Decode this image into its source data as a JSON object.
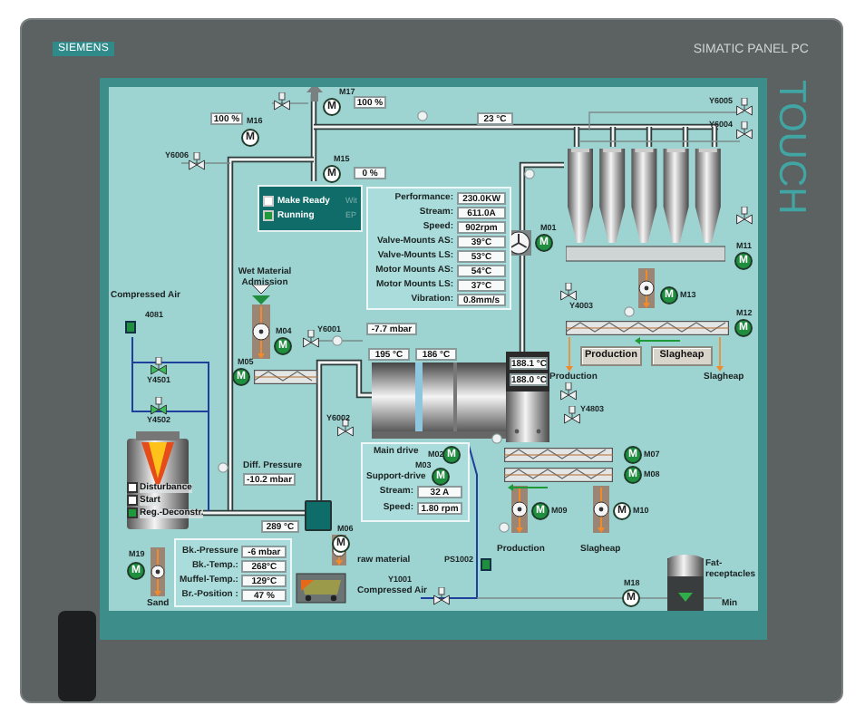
{
  "bezel": {
    "brand": "SIEMENS",
    "model": "SIMATIC PANEL PC",
    "touch_label": "TOUCH"
  },
  "motors": [
    {
      "label": "M17",
      "glyph": "M",
      "running": false
    },
    {
      "label": "M16",
      "glyph": "M",
      "running": false
    },
    {
      "label": "M15",
      "glyph": "M",
      "running": false
    },
    {
      "label": "M01",
      "glyph": "M",
      "running": true
    },
    {
      "label": "M11",
      "glyph": "M",
      "running": true
    },
    {
      "label": "M13",
      "glyph": "M",
      "running": true
    },
    {
      "label": "M12",
      "glyph": "M",
      "running": true
    },
    {
      "label": "M04",
      "glyph": "M",
      "running": true
    },
    {
      "label": "M05",
      "glyph": "M",
      "running": true
    },
    {
      "label": "M02",
      "glyph": "M",
      "running": true
    },
    {
      "label": "M03",
      "glyph": "M",
      "running": true
    },
    {
      "label": "M07",
      "glyph": "M",
      "running": true
    },
    {
      "label": "M08",
      "glyph": "M",
      "running": true
    },
    {
      "label": "M09",
      "glyph": "M",
      "running": true
    },
    {
      "label": "M10",
      "glyph": "M",
      "running": false
    },
    {
      "label": "M06",
      "glyph": "M",
      "running": false
    },
    {
      "label": "M19",
      "glyph": "M",
      "running": true
    },
    {
      "label": "M18",
      "glyph": "M",
      "running": false
    }
  ],
  "valves": [
    {
      "open": false
    },
    {
      "tag": "Y6006",
      "open": false
    },
    {
      "tag": "Y6005",
      "open": false
    },
    {
      "tag": "Y6004",
      "open": false
    },
    {
      "open": false
    },
    {
      "tag": "Y4003",
      "open": false
    },
    {
      "open": false
    },
    {
      "tag": "Y4803",
      "open": false
    },
    {
      "tag": "Y6001",
      "open": false
    },
    {
      "tag": "Y6002",
      "open": false
    },
    {
      "tag": "Y4501",
      "open": true
    },
    {
      "tag": "Y4502",
      "open": true
    },
    {
      "tag": "Y1001",
      "open": false
    }
  ],
  "sensors": [
    {
      "tag": "4081"
    },
    {
      "tag": "PS1002"
    }
  ],
  "readouts": [
    {
      "text": "100 %"
    },
    {
      "text": "100 %"
    },
    {
      "text": "0 %"
    },
    {
      "text": "23 °C"
    },
    {
      "text": "-7.7 mbar"
    },
    {
      "text": "195 °C"
    },
    {
      "text": "186 °C"
    },
    {
      "text": "188.1 °C"
    },
    {
      "text": "188.0 °C"
    },
    {
      "text": "289 °C"
    }
  ],
  "status_panel": {
    "items": [
      {
        "label": "Make Ready",
        "on": false
      },
      {
        "label": "Running",
        "on": true
      }
    ],
    "notes": [
      "Wit",
      "EP"
    ]
  },
  "performance": {
    "rows": [
      {
        "label": "Performance:",
        "value": "230.0KW"
      },
      {
        "label": "Stream:",
        "value": "611.0A"
      },
      {
        "label": "Speed:",
        "value": "902rpm"
      },
      {
        "label": "Valve-Mounts AS:",
        "value": "39°C"
      },
      {
        "label": "Valve-Mounts LS:",
        "value": "53°C"
      },
      {
        "label": "Motor Mounts AS:",
        "value": "54°C"
      },
      {
        "label": "Motor Mounts LS:",
        "value": "37°C"
      },
      {
        "label": "Vibration:",
        "value": "0.8mm/s"
      }
    ]
  },
  "drive_panel": {
    "main_drive": "Main drive",
    "support_drive": "Support-drive",
    "rows": [
      {
        "label": "Stream:",
        "value": "32 A"
      },
      {
        "label": "Speed:",
        "value": "1.80 rpm"
      }
    ]
  },
  "furnace": {
    "items": [
      {
        "label": "Disturbance",
        "on": false
      },
      {
        "label": "Start",
        "on": false
      },
      {
        "label": "Reg.-Deconstr.",
        "on": true
      }
    ]
  },
  "diff_pressure": {
    "label": "Diff. Pressure",
    "value": "-10.2 mbar"
  },
  "burner_panel": {
    "rows": [
      {
        "label": "Bk.-Pressure",
        "value": "-6 mbar"
      },
      {
        "label": "Bk.-Temp.:",
        "value": "268°C"
      },
      {
        "label": "Muffel-Temp.:",
        "value": "129°C"
      },
      {
        "label": "Br.-Position :",
        "value": "47 %"
      }
    ]
  },
  "buttons": [
    {
      "label": "Production"
    },
    {
      "label": "Slagheap"
    }
  ],
  "labels": [
    {
      "text": "Compressed Air"
    },
    {
      "text": "Wet Material Admission"
    },
    {
      "text": "Production"
    },
    {
      "text": "Slagheap"
    },
    {
      "text": "raw material"
    },
    {
      "text": "Sand"
    },
    {
      "text": "Production"
    },
    {
      "text": "Slagheap"
    },
    {
      "text": "Compressed Air"
    },
    {
      "text": "Fat-receptacles"
    },
    {
      "text": "Min"
    }
  ]
}
